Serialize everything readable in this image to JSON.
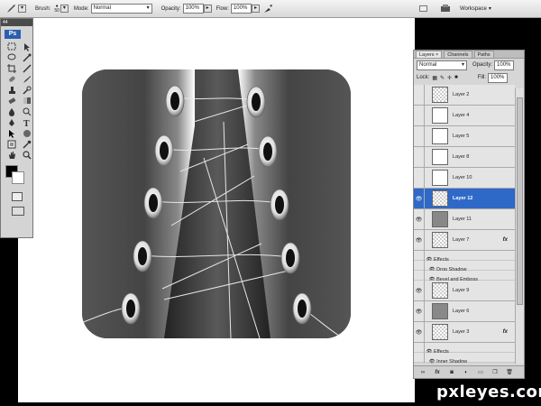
{
  "options_bar": {
    "tool_icon": "brush-icon",
    "brush_label": "Brush:",
    "brush_size": "50",
    "mode_label": "Mode:",
    "mode_value": "Normal",
    "opacity_label": "Opacity:",
    "opacity_value": "100%",
    "flow_label": "Flow:",
    "flow_value": "100%",
    "workspace_label": "Workspace"
  },
  "toolbox": {
    "header": "44",
    "logo": "Ps",
    "foreground_color": "#000000",
    "background_color": "#ffffff"
  },
  "layers_panel": {
    "tabs": [
      "Layers",
      "Channels",
      "Paths"
    ],
    "blend_mode": "Normal",
    "opacity_label": "Opacity:",
    "opacity_value": "100%",
    "lock_label": "Lock:",
    "fill_label": "Fill:",
    "fill_value": "100%",
    "layers": [
      {
        "name": "Layer 2",
        "visible": false
      },
      {
        "name": "Layer 4",
        "visible": false
      },
      {
        "name": "Layer 5",
        "visible": false
      },
      {
        "name": "Layer 8",
        "visible": false
      },
      {
        "name": "Layer 10",
        "visible": false
      },
      {
        "name": "Layer 12",
        "visible": true,
        "selected": true
      },
      {
        "name": "Layer 11",
        "visible": true
      },
      {
        "name": "Layer 7",
        "visible": true,
        "has_effects": true
      },
      {
        "name": "Layer 9",
        "visible": true
      },
      {
        "name": "Layer 6",
        "visible": true
      },
      {
        "name": "Layer 3",
        "visible": true,
        "has_effects": true
      }
    ],
    "fx_label": "fx",
    "effects_label": "Effects",
    "layer7_effects": [
      "Drop Shadow",
      "Bevel and Emboss"
    ],
    "layer3_effects": [
      "Inner Shadow"
    ]
  },
  "watermark": "pxleyes.com",
  "colors": {
    "selection": "#2f69c8",
    "canvas_bg": "#ffffff",
    "app_bg": "#000000"
  }
}
